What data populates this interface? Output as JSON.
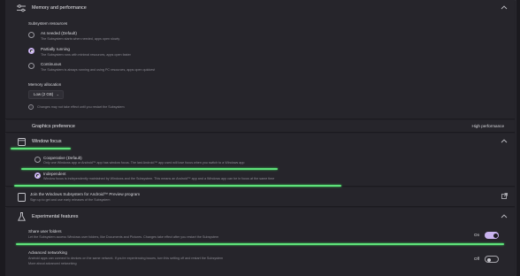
{
  "memory": {
    "section_title": "Memory and performance",
    "resources_label": "Subsystem resources",
    "options": [
      {
        "label": "As needed (Default)",
        "desc": "The Subsystem starts when needed, apps open slowly"
      },
      {
        "label": "Partially running",
        "desc": "The Subsystem runs with minimal resources, apps open faster"
      },
      {
        "label": "Continuous",
        "desc": "The Subsystem is always running and using PC resources, apps open quickest"
      }
    ],
    "selected_index": 1,
    "allocation_label": "Memory allocation",
    "allocation_value": "Low (2 GB)",
    "info_text": "Changes may not take effect until you restart the Subsystem"
  },
  "graphics": {
    "title": "Graphics preference",
    "value": "High performance"
  },
  "window_focus": {
    "title": "Window focus",
    "options": [
      {
        "label": "Cooperative (Default)",
        "desc": "Only one Windows app or Android™ app has window focus. The last Android™ app used will lose focus when you switch to a Windows app"
      },
      {
        "label": "Independent",
        "desc": "Window focus is independently maintained by Windows and the Subsystem. This means an Android™ app and a Windows app can be in focus at the same time"
      }
    ],
    "selected_index": 1
  },
  "preview": {
    "title": "Join the Windows Subsystem for Android™ Preview program",
    "desc": "Sign up to get and use early releases of the Subsystem"
  },
  "experimental": {
    "title": "Experimental features",
    "share_folders": {
      "label": "Share user folders",
      "desc": "Let the Subsystem access Windows user folders, like Documents and Pictures. Changes take effect after you restart the Subsystem",
      "state": "On"
    },
    "advanced_networking": {
      "label": "Advanced networking",
      "desc": "Android apps can connect to devices on the same network. If you're experiencing issues, turn this setting off and restart the Subsystem",
      "desc2": "More about advanced networking",
      "state": "Off"
    }
  },
  "colors": {
    "accent": "#c9b3ef",
    "annotation": "#5fe27a",
    "background": "#1b1a1f"
  }
}
